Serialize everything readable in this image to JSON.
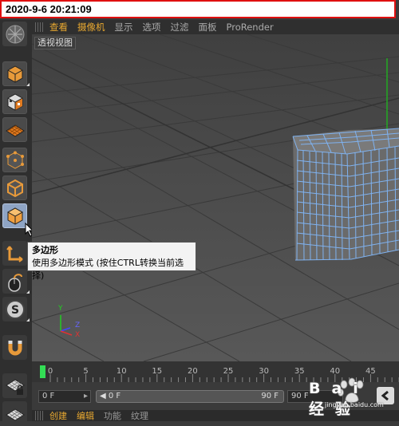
{
  "timestamp": "2020-9-6 20:21:09",
  "menu": {
    "items": [
      {
        "label": "查看",
        "highlight": true
      },
      {
        "label": "摄像机",
        "highlight": true
      },
      {
        "label": "显示",
        "highlight": false
      },
      {
        "label": "选项",
        "highlight": false
      },
      {
        "label": "过滤",
        "highlight": false
      },
      {
        "label": "面板",
        "highlight": false
      },
      {
        "label": "ProRender",
        "highlight": false
      }
    ]
  },
  "viewport": {
    "label": "透视视图",
    "axes": {
      "y": "Y",
      "z": "Z",
      "x": "X"
    }
  },
  "tooltip": {
    "title": "多边形",
    "desc": "使用多边形模式 (按住CTRL转换当前选择)"
  },
  "timeline": {
    "ticks": [
      "0",
      "5",
      "10",
      "15",
      "20",
      "25",
      "30",
      "35",
      "40",
      "45",
      "50"
    ],
    "current_frame": 0
  },
  "controls": {
    "start_field": "0 F",
    "range_start": "◀ 0 F",
    "range_end": "90 F",
    "end_field": "90 F"
  },
  "bottom_tabs": [
    {
      "label": "创建",
      "highlight": true
    },
    {
      "label": "编辑",
      "highlight": true
    },
    {
      "label": "功能",
      "highlight": false
    },
    {
      "label": "纹理",
      "highlight": false
    }
  ],
  "watermark": {
    "text": "Bai 经验",
    "sub": "jingyan.baidu.com"
  },
  "colors": {
    "stamp_border": "#e01010",
    "highlight": "#e8a830",
    "mesh": "#7fb2f0",
    "active_tool": "#8ea4c4"
  },
  "toolbar_icons": [
    "c4d-logo-icon",
    "model-mode-icon",
    "texture-mode-icon",
    "workplane-icon",
    "point-mode-icon",
    "edge-mode-icon",
    "polygon-mode-icon",
    "axis-icon",
    "tweak-mouse-icon",
    "snap-icon",
    "magnet-icon",
    "lock-workplane-icon",
    "grid-icon"
  ]
}
